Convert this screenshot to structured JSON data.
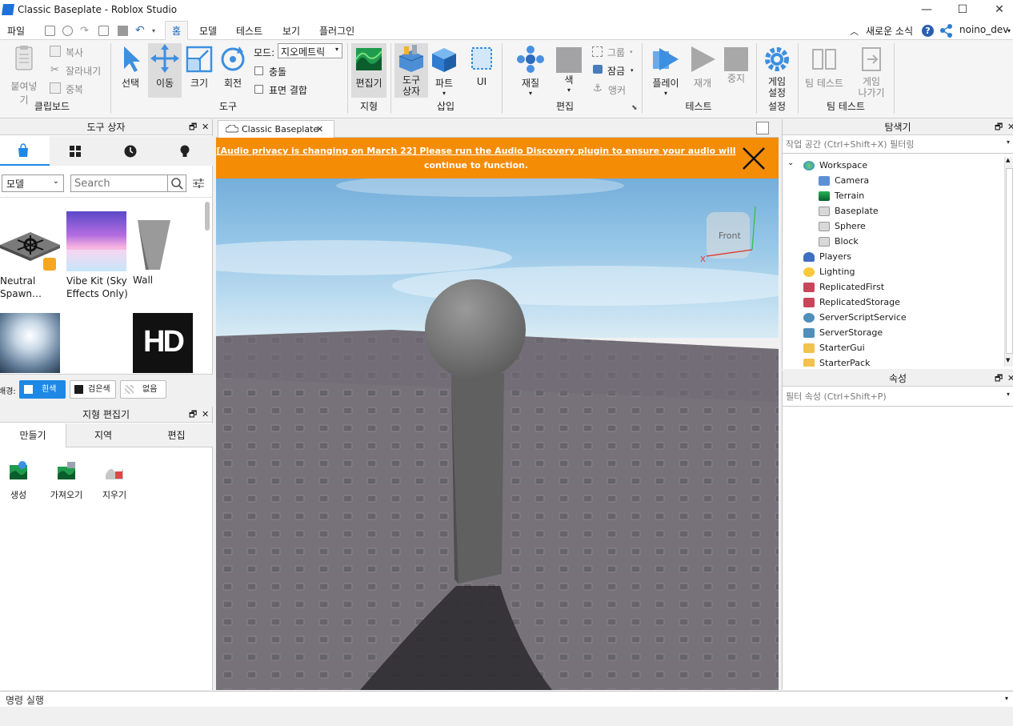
{
  "window": {
    "title": "Classic Baseplate - Roblox Studio",
    "controls": [
      "—",
      "☐",
      "✕"
    ]
  },
  "menu": {
    "items": [
      "파일",
      "홈",
      "모델",
      "테스트",
      "보기",
      "플러그인"
    ],
    "active": "홈",
    "right": {
      "news": "새로운 소식",
      "username": "noino_dev"
    }
  },
  "ribbon": {
    "clipboard": {
      "paste": "붙여넣기",
      "copy": "복사",
      "cut": "잘라내기",
      "duplicate": "중복",
      "label": "클립보드"
    },
    "tools": {
      "select": "선택",
      "move": "이동",
      "scale": "크기",
      "rotate": "회전",
      "mode_label": "모드:",
      "mode_value": "지오메트릭",
      "collision": "충돌",
      "join_surfaces": "표면 결합",
      "label": "도구"
    },
    "terrain": {
      "editor_line1": "편집기",
      "label": "지형"
    },
    "insert": {
      "toolbox_line1": "도구",
      "toolbox_line2": "상자",
      "part": "파트",
      "ui": "UI",
      "label": "삽입"
    },
    "edit": {
      "material": "재질",
      "color": "색",
      "group": "그룹",
      "lock": "잠금",
      "anchor": "앵커",
      "label": "편집"
    },
    "test": {
      "play": "플레이",
      "resume": "재개",
      "stop": "중지",
      "label": "테스트"
    },
    "settings": {
      "game_settings_line1": "게임",
      "game_settings_line2": "설정",
      "label": "설정"
    },
    "team_test": {
      "team_test": "팀 테스트",
      "exit_game_line1": "게임",
      "exit_game_line2": "나가기",
      "label": "팀 테스트"
    }
  },
  "toolbox": {
    "title": "도구 상자",
    "category": "모델",
    "search_placeholder": "Search",
    "items": [
      {
        "line1": "Neutral",
        "line2": "Spawn…"
      },
      {
        "line1": "Vibe Kit (Sky",
        "line2": "Effects Only)"
      },
      {
        "line1": "Wall",
        "line2": ""
      }
    ],
    "hd_text": "HD",
    "background_label": "배경:",
    "bg_white": "흰색",
    "bg_black": "검은색",
    "bg_none": "없음"
  },
  "terrain_editor": {
    "title": "지형 편집기",
    "tabs": [
      "만들기",
      "지역",
      "편집"
    ],
    "tools": [
      "생성",
      "가져오기",
      "지우기"
    ]
  },
  "document": {
    "tab_label": "Classic Baseplate",
    "banner_line1": "[Audio privacy is changing on March 22] Please run the Audio Discovery plugin to ensure your audio will",
    "banner_line2": "continue to function.",
    "gizmo_face": "Front",
    "gizmo_axis_x": "X"
  },
  "explorer": {
    "title": "탐색기",
    "filter_placeholder": "작업 공간 (Ctrl+Shift+X) 필터링",
    "tree": [
      {
        "label": "Workspace",
        "depth": 0,
        "icon": "globe-icon"
      },
      {
        "label": "Camera",
        "depth": 1,
        "icon": "camera-icon"
      },
      {
        "label": "Terrain",
        "depth": 1,
        "icon": "terrain-icon"
      },
      {
        "label": "Baseplate",
        "depth": 1,
        "icon": "part-icon"
      },
      {
        "label": "Sphere",
        "depth": 1,
        "icon": "part-icon"
      },
      {
        "label": "Block",
        "depth": 1,
        "icon": "part-icon"
      },
      {
        "label": "Players",
        "depth": 0,
        "icon": "players-icon"
      },
      {
        "label": "Lighting",
        "depth": 0,
        "icon": "lightbulb-icon"
      },
      {
        "label": "ReplicatedFirst",
        "depth": 0,
        "icon": "replicated-icon"
      },
      {
        "label": "ReplicatedStorage",
        "depth": 0,
        "icon": "replicated-icon"
      },
      {
        "label": "ServerScriptService",
        "depth": 0,
        "icon": "script-service-icon"
      },
      {
        "label": "ServerStorage",
        "depth": 0,
        "icon": "storage-icon"
      },
      {
        "label": "StarterGui",
        "depth": 0,
        "icon": "folder-icon"
      },
      {
        "label": "StarterPack",
        "depth": 0,
        "icon": "folder-icon"
      }
    ]
  },
  "properties": {
    "title": "속성",
    "filter_placeholder": "필터 속성 (Ctrl+Shift+P)"
  },
  "command_bar": {
    "placeholder": "명령 실행"
  },
  "colors": {
    "banner_bg": "#f48c06",
    "accent": "#1e88e5",
    "sky_top": "#6aa9d6",
    "ground": "#77727a"
  }
}
